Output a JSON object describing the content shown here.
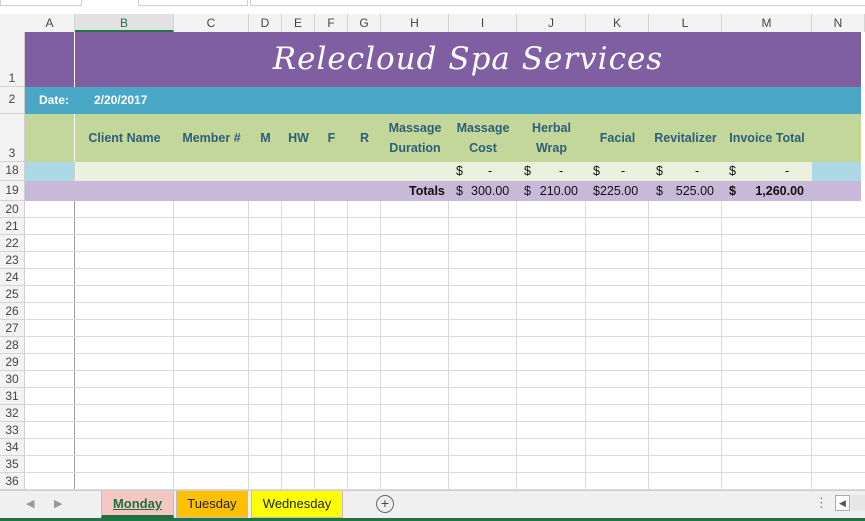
{
  "sheet": {
    "title": "Relecloud Spa Services",
    "date_label": "Date:",
    "date_value": "2/20/2017"
  },
  "columns": [
    "A",
    "B",
    "C",
    "D",
    "E",
    "F",
    "G",
    "H",
    "I",
    "J",
    "K",
    "L",
    "M",
    "N"
  ],
  "selected_column": "B",
  "rows": {
    "r1": "1",
    "r2": "2",
    "r3": "3",
    "r18": "18",
    "r19": "19",
    "empty": [
      "20",
      "21",
      "22",
      "23",
      "24",
      "25",
      "26",
      "27",
      "28",
      "29",
      "30",
      "31",
      "32",
      "33",
      "34",
      "35",
      "36"
    ]
  },
  "headers": {
    "client_name": "Client Name",
    "member": "Member #",
    "m": "M",
    "hw": "HW",
    "f": "F",
    "r": "R",
    "massage_duration_1": "Massage",
    "massage_duration_2": "Duration",
    "massage_cost_1": "Massage",
    "massage_cost_2": "Cost",
    "herbal_wrap_1": "Herbal",
    "herbal_wrap_2": "Wrap",
    "facial": "Facial",
    "revitalizer": "Revitalizer",
    "invoice_total": "Invoice Total"
  },
  "row18": {
    "currency": "$",
    "dash": "-"
  },
  "totals": {
    "label": "Totals",
    "currency": "$",
    "massage_cost": "300.00",
    "herbal_wrap": "210.00",
    "facial": "$225.00",
    "revitalizer": "525.00",
    "invoice_total": "1,260.00"
  },
  "tabs": [
    {
      "label": "Monday",
      "active": true,
      "color": "#f4c7c3"
    },
    {
      "label": "Tuesday",
      "active": false,
      "color": "#ffc000"
    },
    {
      "label": "Wednesday",
      "active": false,
      "color": "#ffff00"
    }
  ],
  "colors": {
    "title_band": "#7f5fa2",
    "date_band": "#4aa8c6",
    "header_band": "#c4d79b",
    "totals_band": "#c9b9d9",
    "excel_green": "#217346"
  },
  "icons": {
    "add_sheet": "plus-circle-icon",
    "nav_prev": "chevron-left-icon",
    "nav_next": "chevron-right-icon"
  }
}
